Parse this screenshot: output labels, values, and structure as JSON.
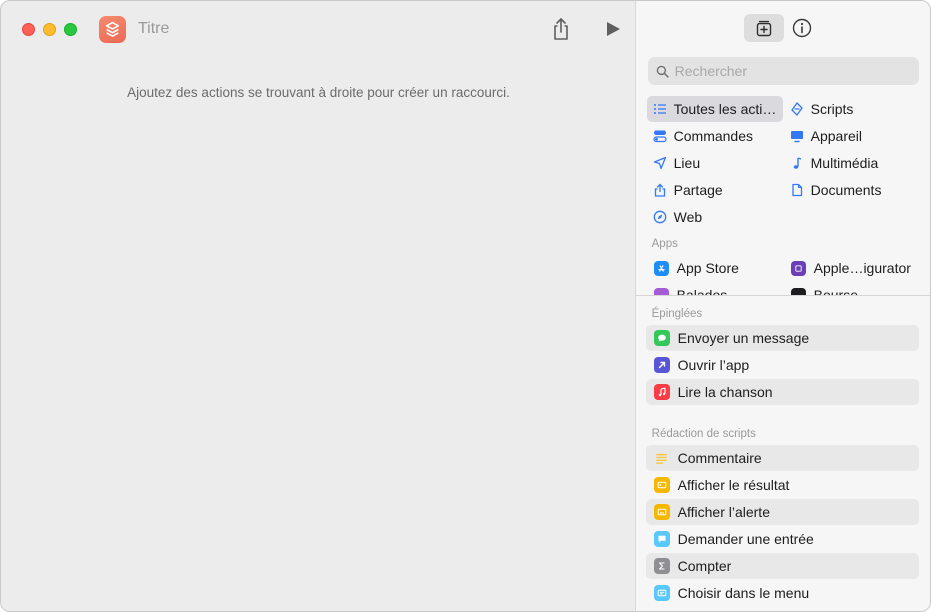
{
  "window": {
    "title": "Titre"
  },
  "editor": {
    "hint": "Ajoutez des actions se trouvant à droite pour créer un raccourci."
  },
  "library": {
    "search_placeholder": "Rechercher",
    "categories": [
      {
        "label": "Toutes les acti…",
        "icon": "list-icon",
        "color": "#3478f6",
        "selected": true
      },
      {
        "label": "Scripts",
        "icon": "scripts-icon",
        "color": "#3478f6"
      },
      {
        "label": "Commandes",
        "icon": "toggle-icon",
        "color": "#3478f6"
      },
      {
        "label": "Appareil",
        "icon": "desktop-icon",
        "color": "#3478f6"
      },
      {
        "label": "Lieu",
        "icon": "location-arrow-icon",
        "color": "#3478f6"
      },
      {
        "label": "Multimédia",
        "icon": "music-note-icon",
        "color": "#3478f6"
      },
      {
        "label": "Partage",
        "icon": "share-icon",
        "color": "#3478f6"
      },
      {
        "label": "Documents",
        "icon": "document-icon",
        "color": "#3478f6"
      },
      {
        "label": "Web",
        "icon": "compass-icon",
        "color": "#3478f6"
      }
    ],
    "apps_label": "Apps",
    "apps": [
      {
        "label": "App Store",
        "icon": "app-store-icon",
        "color": "#1e8df5"
      },
      {
        "label": "Apple…igurator",
        "icon": "apple-configurator-icon",
        "color": "#6b3fb5"
      },
      {
        "label": "Balados",
        "icon": "podcasts-icon",
        "color": "#a55bd6"
      },
      {
        "label": "Bourse",
        "icon": "stocks-icon",
        "color": "#1d1d1f"
      }
    ],
    "pinned_label": "Épinglées",
    "pinned": [
      {
        "label": "Envoyer un message",
        "icon": "message-icon",
        "color": "#34c759"
      },
      {
        "label": "Ouvrir l’app",
        "icon": "open-app-icon",
        "color": "#5856d6"
      },
      {
        "label": "Lire la chanson",
        "icon": "music-note-icon",
        "color": "#fc3c44"
      }
    ],
    "scripting_label": "Rédaction de scripts",
    "scripting": [
      {
        "label": "Commentaire",
        "icon": "comment-lines-icon",
        "color": "#f5c542"
      },
      {
        "label": "Afficher le résultat",
        "icon": "show-result-icon",
        "color": "#f5b700"
      },
      {
        "label": "Afficher l’alerte",
        "icon": "alert-icon",
        "color": "#f5b700"
      },
      {
        "label": "Demander une entrée",
        "icon": "ask-input-icon",
        "color": "#5ac8fa"
      },
      {
        "label": "Compter",
        "icon": "sigma-icon",
        "color": "#8e8e93"
      },
      {
        "label": "Choisir dans le menu",
        "icon": "menu-icon",
        "color": "#5ac8fa"
      }
    ]
  }
}
